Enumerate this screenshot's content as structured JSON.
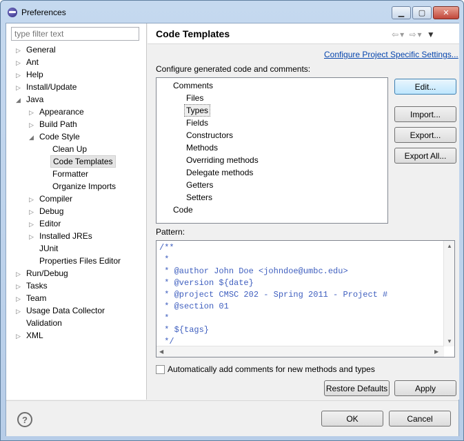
{
  "window": {
    "title": "Preferences",
    "min_icon": "minimize-icon",
    "max_icon": "maximize-icon",
    "close_icon": "close-icon"
  },
  "left": {
    "filter_placeholder": "type filter text",
    "tree": [
      {
        "label": "General",
        "expander": "▷",
        "level": 0
      },
      {
        "label": "Ant",
        "expander": "▷",
        "level": 0
      },
      {
        "label": "Help",
        "expander": "▷",
        "level": 0
      },
      {
        "label": "Install/Update",
        "expander": "▷",
        "level": 0
      },
      {
        "label": "Java",
        "expander": "◢",
        "level": 0
      },
      {
        "label": "Appearance",
        "expander": "▷",
        "level": 1
      },
      {
        "label": "Build Path",
        "expander": "▷",
        "level": 1
      },
      {
        "label": "Code Style",
        "expander": "◢",
        "level": 1
      },
      {
        "label": "Clean Up",
        "expander": "",
        "level": 2
      },
      {
        "label": "Code Templates",
        "expander": "",
        "level": 2,
        "selected": true
      },
      {
        "label": "Formatter",
        "expander": "",
        "level": 2
      },
      {
        "label": "Organize Imports",
        "expander": "",
        "level": 2
      },
      {
        "label": "Compiler",
        "expander": "▷",
        "level": 1
      },
      {
        "label": "Debug",
        "expander": "▷",
        "level": 1
      },
      {
        "label": "Editor",
        "expander": "▷",
        "level": 1
      },
      {
        "label": "Installed JREs",
        "expander": "▷",
        "level": 1
      },
      {
        "label": "JUnit",
        "expander": "",
        "level": 1
      },
      {
        "label": "Properties Files Editor",
        "expander": "",
        "level": 1
      },
      {
        "label": "Run/Debug",
        "expander": "▷",
        "level": 0
      },
      {
        "label": "Tasks",
        "expander": "▷",
        "level": 0
      },
      {
        "label": "Team",
        "expander": "▷",
        "level": 0
      },
      {
        "label": "Usage Data Collector",
        "expander": "▷",
        "level": 0
      },
      {
        "label": "Validation",
        "expander": "",
        "level": 0
      },
      {
        "label": "XML",
        "expander": "▷",
        "level": 0
      }
    ]
  },
  "right": {
    "title": "Code Templates",
    "link": "Configure Project Specific Settings...",
    "caption": "Configure generated code and comments:",
    "templates": [
      {
        "label": "Comments",
        "level": 0
      },
      {
        "label": "Files",
        "level": 1
      },
      {
        "label": "Types",
        "level": 1,
        "selected": true
      },
      {
        "label": "Fields",
        "level": 1
      },
      {
        "label": "Constructors",
        "level": 1
      },
      {
        "label": "Methods",
        "level": 1
      },
      {
        "label": "Overriding methods",
        "level": 1
      },
      {
        "label": "Delegate methods",
        "level": 1
      },
      {
        "label": "Getters",
        "level": 1
      },
      {
        "label": "Setters",
        "level": 1
      },
      {
        "label": "Code",
        "level": 0
      }
    ],
    "buttons": {
      "edit": "Edit...",
      "import": "Import...",
      "export": "Export...",
      "export_all": "Export All..."
    },
    "pattern_label": "Pattern:",
    "pattern_lines": [
      "/**",
      " *",
      " * @author John Doe <johndoe@umbc.edu>",
      " * @version ${date}",
      " * @project CMSC 202 - Spring 2011 - Project #",
      " * @section 01",
      " *",
      " * ${tags}",
      " */"
    ],
    "auto_comment_label": "Automatically add comments for new methods and types",
    "restore_defaults": "Restore Defaults",
    "apply": "Apply"
  },
  "bottom": {
    "ok": "OK",
    "cancel": "Cancel",
    "help_icon": "help-icon"
  }
}
